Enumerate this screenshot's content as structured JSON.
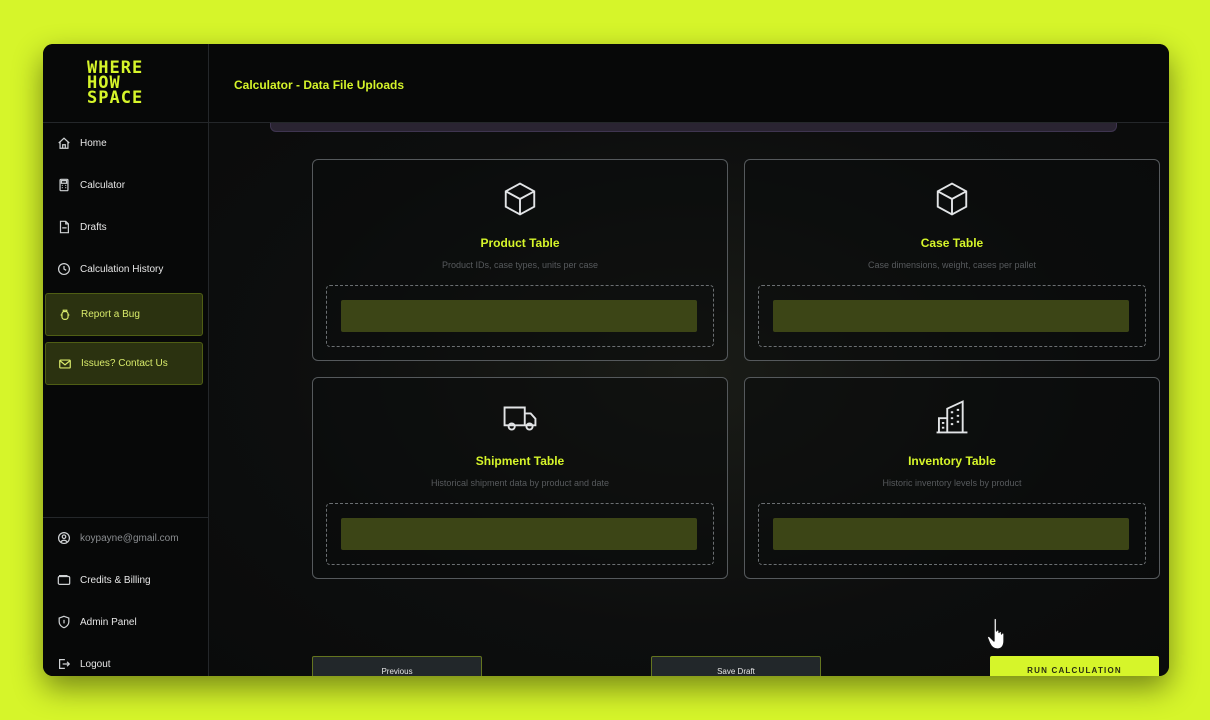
{
  "logo": {
    "lines": [
      "WHERE",
      "HOW",
      "SPACE"
    ]
  },
  "header": {
    "title": "Calculator - Data File Uploads"
  },
  "sidebar": {
    "items": [
      {
        "label": "Home",
        "icon": "home-icon"
      },
      {
        "label": "Calculator",
        "icon": "calculator-icon"
      },
      {
        "label": "Drafts",
        "icon": "document-icon"
      },
      {
        "label": "Calculation History",
        "icon": "clock-icon"
      },
      {
        "label": "Report a Bug",
        "icon": "bug-icon"
      },
      {
        "label": "Issues? Contact Us",
        "icon": "mail-icon"
      }
    ],
    "footer": [
      {
        "label": "koypayne@gmail.com",
        "icon": "user-icon"
      },
      {
        "label": "Credits & Billing",
        "icon": "wallet-icon"
      },
      {
        "label": "Admin Panel",
        "icon": "shield-icon"
      },
      {
        "label": "Logout",
        "icon": "logout-icon"
      }
    ]
  },
  "cards": [
    {
      "title": "Product Table",
      "subtitle": "Product IDs, case types, units per case",
      "icon": "box-icon"
    },
    {
      "title": "Case Table",
      "subtitle": "Case dimensions, weight, cases per pallet",
      "icon": "box-icon"
    },
    {
      "title": "Shipment Table",
      "subtitle": "Historical shipment data by product and date",
      "icon": "truck-icon"
    },
    {
      "title": "Inventory Table",
      "subtitle": "Historic inventory levels by product",
      "icon": "building-icon"
    }
  ],
  "buttons": {
    "previous": "Previous",
    "save_draft": "Save Draft",
    "run": "RUN CALCULATION"
  },
  "colors": {
    "accent": "#d6f52a",
    "background": "#0b0c0d"
  }
}
